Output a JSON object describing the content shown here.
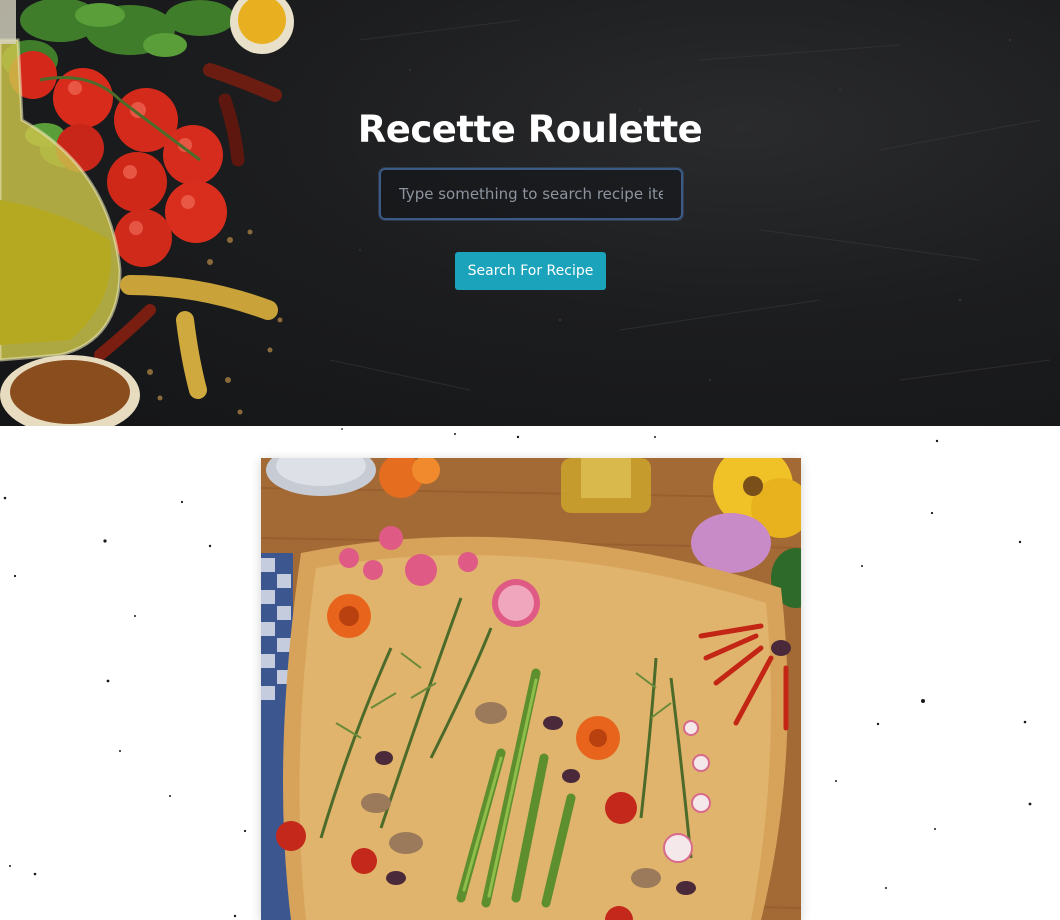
{
  "app": {
    "title": "Recette Roulette"
  },
  "search": {
    "placeholder": "Type something to search recipe item",
    "value": "",
    "button_label": "Search For Recipe"
  },
  "colors": {
    "hero_background": "#1c1d1f",
    "accent_button": "#1aa3bb",
    "input_border": "#3b5b86",
    "title_text": "#ffffff",
    "page_background": "#ffffff"
  },
  "results": {
    "cards": [
      {
        "image_subject": "focaccia-garden-art"
      }
    ]
  }
}
